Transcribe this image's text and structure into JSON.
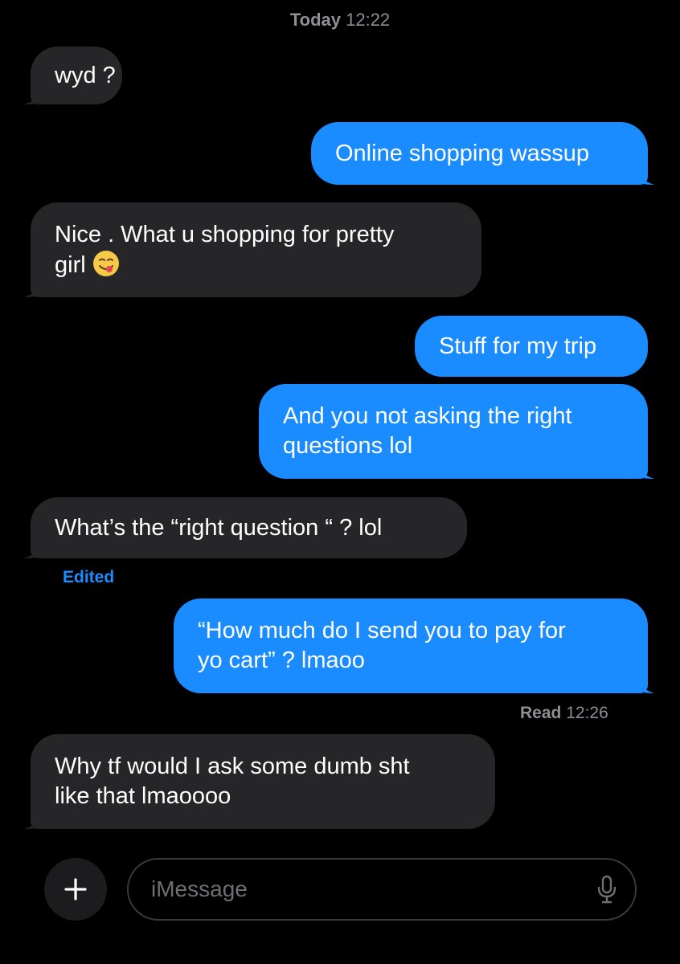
{
  "header": {
    "day": "Today",
    "time": "12:22"
  },
  "messages": [
    {
      "side": "received",
      "text": "wyd ?"
    },
    {
      "side": "sent",
      "text": "Online shopping wassup"
    },
    {
      "side": "received",
      "line1": "Nice . What u shopping for pretty",
      "line2": "girl",
      "emoji": "face-savoring-food-emoji"
    },
    {
      "side": "sent",
      "text": "Stuff for my trip"
    },
    {
      "side": "sent",
      "line1": "And you not asking the right",
      "line2": "questions lol"
    },
    {
      "side": "received",
      "text": "What’s the “right question “  ? lol"
    },
    {
      "side": "sent",
      "line1": "“How much do I send you to pay for",
      "line2": "yo cart” ? lmaoo"
    },
    {
      "side": "received",
      "line1": "Why tf would I ask some dumb sht",
      "line2": "like that lmaoooo"
    }
  ],
  "edited_label": "Edited",
  "read_receipt": {
    "label": "Read",
    "time": "12:26"
  },
  "composer": {
    "placeholder": "iMessage",
    "plus_icon": "plus-icon",
    "mic_icon": "microphone-icon"
  },
  "colors": {
    "sent_bubble": "#1a8cff",
    "received_bubble": "#262629",
    "background": "#000000",
    "meta_text": "#8e8e93"
  }
}
